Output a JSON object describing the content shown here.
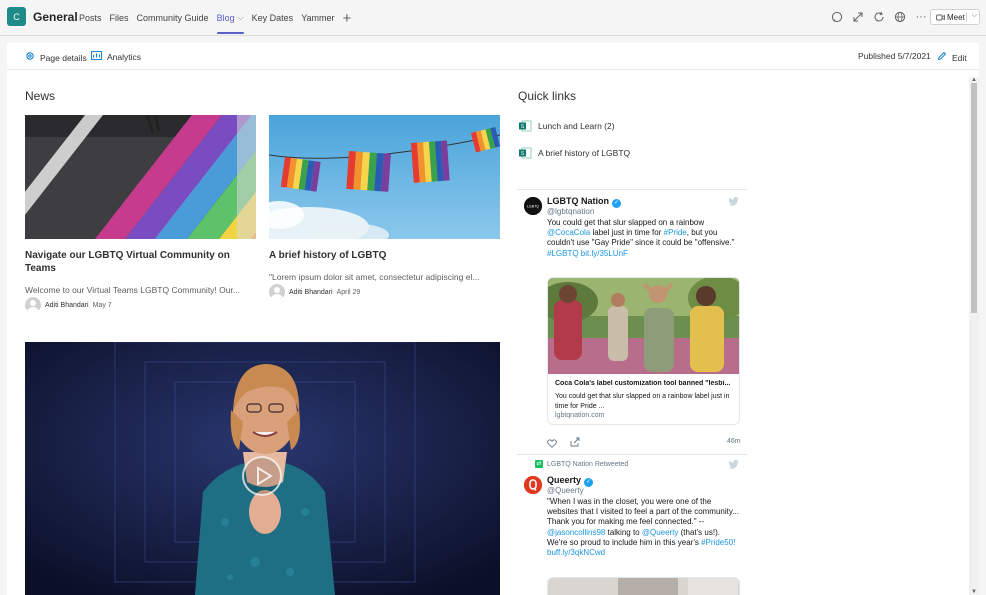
{
  "topbar": {
    "team_initial": "C",
    "channel": "General",
    "tabs": [
      {
        "label": "Posts"
      },
      {
        "label": "Files"
      },
      {
        "label": "Community Guide"
      },
      {
        "label": "Blog"
      },
      {
        "label": "Key Dates"
      },
      {
        "label": "Yammer"
      }
    ],
    "meet_label": "Meet"
  },
  "commandbar": {
    "page_details": "Page details",
    "analytics": "Analytics",
    "published": "Published 5/7/2021",
    "edit": "Edit"
  },
  "news": {
    "title": "News",
    "items": [
      {
        "title": "Navigate our LGBTQ Virtual Community on Teams",
        "description": "Welcome to our Virtual Teams LGBTQ Community! Our...",
        "author": "Aditi Bhandari",
        "date": "May 7"
      },
      {
        "title": "A brief history of LGBTQ",
        "description": "\"Lorem ipsum dolor sit amet, consectetur adipiscing el...",
        "author": "Aditi Bhandari",
        "date": "April 29"
      }
    ]
  },
  "quick_links": {
    "title": "Quick links",
    "items": [
      {
        "label": "Lunch and Learn (2)"
      },
      {
        "label": "A brief history of LGBTQ"
      }
    ]
  },
  "twitter": {
    "tweet1": {
      "name": "LGBTQ Nation",
      "handle": "@lgbtqnation",
      "text_a": "You could get that slur slapped on a rainbow ",
      "link_a": "@CocaCola",
      "text_b": " label just in time for ",
      "link_b": "#Pride",
      "text_c": ", but you couldn't use \"Gay Pride\" since it could be \"offensive.\" ",
      "link_c": "#LGBTQ bit.ly/35LUnF",
      "card_title": "Coca Cola's label customization tool banned \"lesbi...",
      "card_desc": "You could get that slur slapped on a rainbow label just in time for Pride ...",
      "card_domain": "lgbtqnation.com",
      "time": "46m"
    },
    "tweet2": {
      "retweet_label": "LGBTQ Nation Retweeted",
      "name": "Queerty",
      "handle": "@Queerty",
      "text_a": "\"When I was in the closet, you were one of the websites that I visited to feel a part of the community... Thank you for making me feel connected.\" -- ",
      "link_a": "@jasoncollins98",
      "text_b": " talking to ",
      "link_b": "@Queerty",
      "text_c": " (that's us!). We're so proud to include him in this year's ",
      "link_c": "#Pride50! buff.ly/3qkNCwd"
    }
  },
  "colors": {
    "accent": "#5b5fc7",
    "team_avatar": "#1f8a8a",
    "twitter_blue": "#1da1f2",
    "link": "#1b95e0"
  }
}
